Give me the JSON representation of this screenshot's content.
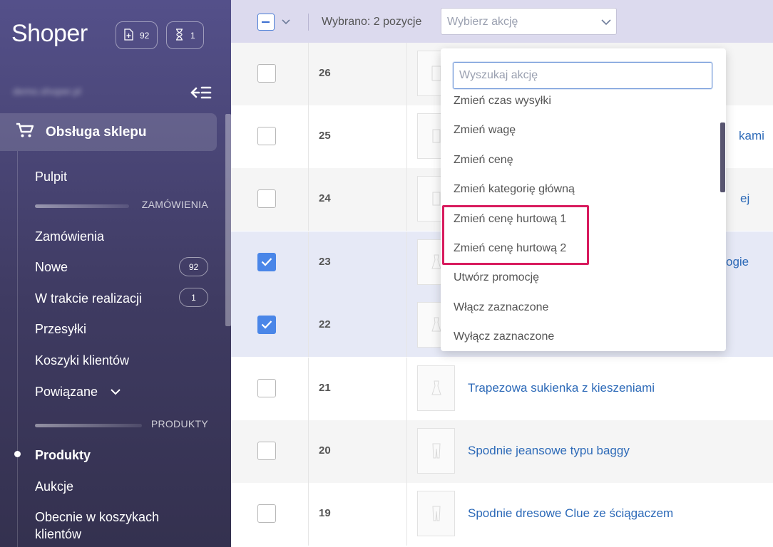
{
  "sidebar": {
    "logo": "Shoper",
    "counter_new_orders": "92",
    "counter_pending": "1",
    "store_url": "demo.shoper.pl",
    "active_section": "Obsługa sklepu",
    "items": {
      "pulpit": "Pulpit",
      "section_orders": "ZAMÓWIENIA",
      "zamowienia": "Zamówienia",
      "nowe": "Nowe",
      "nowe_badge": "92",
      "w_trakcie": "W trakcie realizacji",
      "w_trakcie_badge": "1",
      "przesylki": "Przesyłki",
      "koszyki": "Koszyki klientów",
      "powiazane": "Powiązane",
      "section_products": "PRODUKTY",
      "produkty": "Produkty",
      "aukcje": "Aukcje",
      "obecnie_line1": "Obecnie w koszykach",
      "obecnie_line2": "klientów"
    }
  },
  "toolbar": {
    "selected_text": "Wybrano: 2 pozycje",
    "action_placeholder": "Wybierz akcję"
  },
  "rows": [
    {
      "id": "26",
      "name": "",
      "checked": false
    },
    {
      "id": "25",
      "name": "kami",
      "checked": false
    },
    {
      "id": "24",
      "name": "ej",
      "checked": false
    },
    {
      "id": "23",
      "name": "ogie",
      "checked": true
    },
    {
      "id": "22",
      "name": "",
      "checked": true
    },
    {
      "id": "21",
      "name": "Trapezowa sukienka z kieszeniami",
      "checked": false
    },
    {
      "id": "20",
      "name": "Spodnie jeansowe typu baggy",
      "checked": false
    },
    {
      "id": "19",
      "name": "Spodnie dresowe Clue ze ściągaczem",
      "checked": false
    }
  ],
  "dropdown": {
    "search_placeholder": "Wyszukaj akcję",
    "items": [
      "Zmień czas wysyłki",
      "Zmień wagę",
      "Zmień cenę",
      "Zmień kategorię główną",
      "Zmień cenę hurtową 1",
      "Zmień cenę hurtową 2",
      "Utwórz promocję",
      "Włącz zaznaczone",
      "Wyłącz zaznaczone"
    ]
  },
  "colors": {
    "sidebar_top": "#54508a",
    "sidebar_bottom": "#34314f",
    "toolbar_bg": "#dcdaee",
    "link": "#2d6ab8",
    "checkbox_checked": "#4a86e8",
    "highlight": "#d81b5e"
  }
}
